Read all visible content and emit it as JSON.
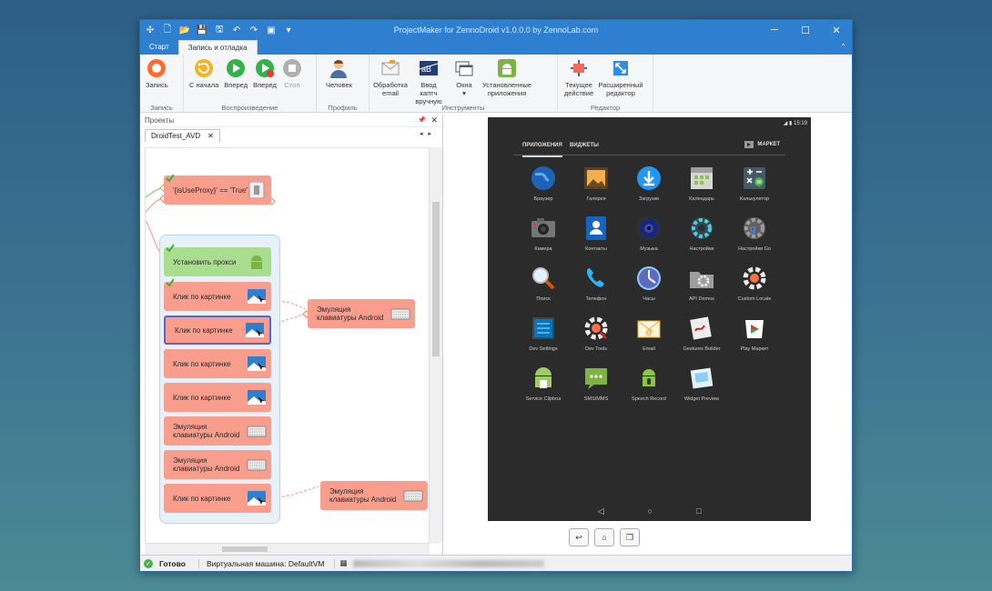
{
  "window": {
    "title": "ProjectMaker for ZennoDroid v1.0.0.0 by ZennoLab.com"
  },
  "ribbon_tabs": [
    {
      "label": "Старт"
    },
    {
      "label": "Запись и отладка"
    }
  ],
  "ribbon": {
    "groups": {
      "record": "Запись",
      "playback": "Воспроизведение",
      "profile": "Профиль",
      "tools": "Инструменты",
      "editor": "Редактор"
    },
    "buttons": {
      "record": "Запись",
      "from_start": "С начала",
      "forward": "Вперед",
      "forward2": "Вперед",
      "stop": "Стоп",
      "human": "Человек",
      "email": "Обработка email",
      "captcha": "Ввод каптч вручную",
      "windows": "Окна",
      "apps": "Установленные приложения",
      "current_action": "Текущее действие",
      "advanced_editor": "Расширенный редактор"
    }
  },
  "projects": {
    "pane_title": "Проекты",
    "doc_tab": "DroidTest_AVD",
    "actions": {
      "condition": "'{isUseProxy}' == 'True'",
      "set_proxy": "Установить прокси",
      "click1": "Клик по картинке",
      "click2": "Клик по картинке",
      "click3": "Клик по картинке",
      "click4": "Клик по картинке",
      "kbd1": "Эмуляция клавиатуры Android",
      "kbd2": "Эмуляция клавиатуры Android",
      "click5": "Клик по картинке",
      "side_kbd1": "Эмуляция клавиатуры Android",
      "side_kbd2": "Эмуляция клавиатуры Android"
    }
  },
  "device": {
    "time": "15:19",
    "tab_apps": "ПРИЛОЖЕНИЯ",
    "tab_widgets": "ВИДЖЕТЫ",
    "market": "МАРКЕТ",
    "apps": [
      {
        "label": "Браузер",
        "icon": "globe-icon"
      },
      {
        "label": "Галерея",
        "icon": "gallery-icon"
      },
      {
        "label": "Загрузки",
        "icon": "download-icon"
      },
      {
        "label": "Календарь",
        "icon": "calendar-icon"
      },
      {
        "label": "Калькулятор",
        "icon": "calculator-icon"
      },
      {
        "label": "Камера",
        "icon": "camera-icon"
      },
      {
        "label": "Контакты",
        "icon": "contacts-icon"
      },
      {
        "label": "Музыка",
        "icon": "music-icon"
      },
      {
        "label": "Настройки",
        "icon": "settings-icon"
      },
      {
        "label": "Настройки Go",
        "icon": "google-settings-icon"
      },
      {
        "label": "Поиск",
        "icon": "search-icon"
      },
      {
        "label": "Телефон",
        "icon": "phone-icon"
      },
      {
        "label": "Часы",
        "icon": "clock-icon"
      },
      {
        "label": "API Demos",
        "icon": "folder-gear-icon"
      },
      {
        "label": "Custom Locale",
        "icon": "gear-orange-icon"
      },
      {
        "label": "Dev Settings",
        "icon": "dev-settings-icon"
      },
      {
        "label": "Dev Tools",
        "icon": "dev-tools-icon"
      },
      {
        "label": "Email",
        "icon": "email-icon"
      },
      {
        "label": "Gestures Builder",
        "icon": "gestures-icon"
      },
      {
        "label": "Play Маркет",
        "icon": "play-store-icon"
      },
      {
        "label": "Service Clipboa",
        "icon": "android-clipboard-icon"
      },
      {
        "label": "SMS/MMS",
        "icon": "sms-icon"
      },
      {
        "label": "Speech Record",
        "icon": "android-mic-icon"
      },
      {
        "label": "Widget Preview",
        "icon": "widget-preview-icon"
      }
    ]
  },
  "statusbar": {
    "status": "Готово",
    "vm": "Виртуальная машина: DefaultVM"
  },
  "colors": {
    "titlebar": "#2f7fd0",
    "action_red": "#f99d8c",
    "action_green": "#a8de8e",
    "device_bg": "#2b2b2b"
  }
}
